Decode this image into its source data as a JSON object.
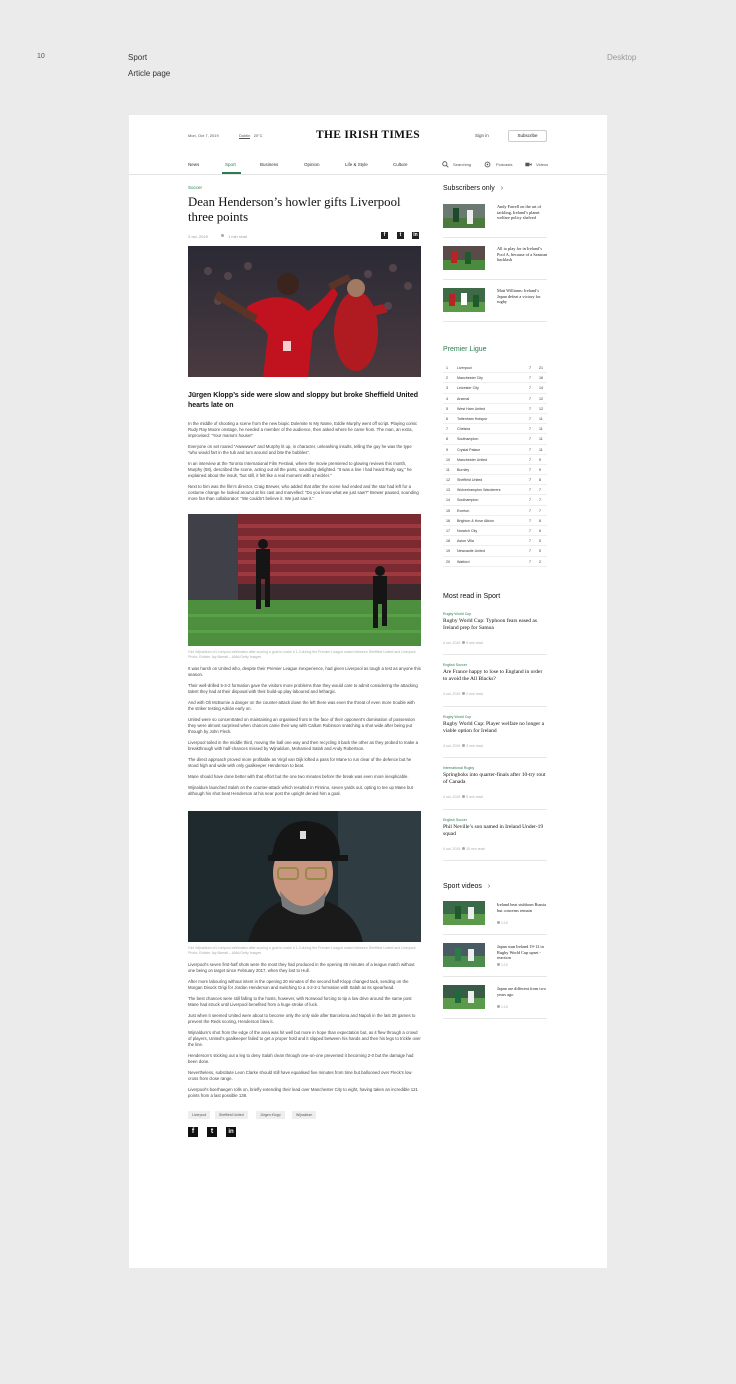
{
  "board": {
    "number": "10",
    "section": "Sport",
    "page": "Article page",
    "device": "Desktop"
  },
  "header": {
    "date": "Mon, Oct 7, 2019",
    "city": "Dublin",
    "temperature": "20°C",
    "logo": "THE IRISH TIMES",
    "signin": "Sign in",
    "subscribe": "Subscribe"
  },
  "nav": {
    "items": [
      "News",
      "Sport",
      "Business",
      "Opinion",
      "Life & Style",
      "Culture"
    ],
    "active": "Sport",
    "tools": [
      "Searching",
      "Podcasts",
      "Videos"
    ]
  },
  "article": {
    "kicker": "Soccer",
    "title": "Dean Henderson’s howler gifts Liverpool three points",
    "date": "2 oct, 2019",
    "read_time": "1 min read",
    "standfirst": "Jürgen Klopp’s side were slow and sloppy but broke Sheffield United hearts late on",
    "paragraphs_a": [
      "In the middle of shooting a scene from the new biopic Dolemite Is My Name, Eddie Murphy went off script. Playing comic Rudy Ray Moore onstage, he needed a member of the audience, then asked where he came from. The man, an extra, improvised: “Your mama’s house!”",
      "Everyone on set roared “Awwwww!” and Murphy lit up, in character, unleashing insults, telling the guy he was the type “who would fart in the tub and turn around and bite the bubbles”.",
      "In an interview at the Toronto International Film Festival, where the movie premiered to glowing reviews this month, Murphy (58), described the scene, acting out all the parts, sounding delighted. “It was a line I had heard Rudy say,” he explained about the insult, “but still, it felt like a real moment with a heckler.”",
      "Next to him was the film’s director, Craig Brewer, who added that after the scene had ended and the star had left for a costume change he looked around at his cast and marvelled: “Do you know what we just saw?” Brewer paused, sounding more fan than collaborator: “We couldn’t believe it. We just saw it.”"
    ],
    "caption1": "Gini Wijnaldum of Liverpool celebrates after scoring a goal to make it 1-0 during the Premier League match between Sheffield United and Liverpool. Photo: Robbie Jay Barratt – AMA/Getty Images",
    "paragraphs_b": [
      "It was harsh on United who, despite their Premier League inexperience, had given Liverpool as tough a test as anyone this season.",
      "Their well-drilled 5-3-2 formation gave the visitors more problems than they would care to admit considering the attacking talent they had at their disposal with their build-up play laboured and lethargic.",
      "And with Oli McBurnie a danger on the counter-attack down the left there was even the threat of even more trouble with the striker testing Adrián early on.",
      "United were so concentrated on maintaining an organised front in the face of their opponent’s domination of possession they were almost surprised when chances came their way with Callum Robinson snatching a shot wide after being put through by John Fleck.",
      "Liverpool toiled in the middle third, moving the ball one way and then recycling it back the other as they probed to make a breakthrough with half-chances missed by Wijnaldum, Mohamed Salah and Andy Robertson.",
      "The direct approach proved more profitable as Virgil van Dijk lofted a pass for Mane to run clear of the defence but he stood high and wide with only goalkeeper Henderson to beat.",
      "Mane should have done better with that effort but the one two minutes before the break was even more inexplicable.",
      "Wijnaldum launched Salah on the counter-attack which resulted in Firmino, seven yards out, opting to tee up Mane but although his shot beat Henderson at his near post the upright denied him a goal."
    ],
    "caption2": "Gini Wijnaldum of Liverpool celebrates after scoring a goal to make it 1-0 during the Premier League match between Sheffield United and Liverpool. Photo: Robbie Jay Barratt – AMA/Getty Images",
    "paragraphs_c": [
      "Liverpool’s seven first-half shots were the most they had produced in the opening 45 minutes of a league match without one being on target since February 2017, when they lost to Hull.",
      "After more labouring without intent in the opening 20 minutes of the second half Klopp changed tack, sending on the Morgan Divock Origi for Jordan Henderson and switching to a 4-2-3-1 formation with Salah as its spearhead.",
      "The best chances were still falling to the hosts, however, with Norwood forcing to tip a low drive around the same post Mane had struck until Liverpool benefited from a huge stroke of luck.",
      "Just when it seemed United were about to become only the only side after Barcelona and Napoli in the last 28 games to prevent the Reds scoring, Henderson blew it.",
      "Wijnaldum’s shot from the edge of the area was hit well but more in hope than expectation but, as it flew through a crowd of players, United’s goalkeeper failed to get a proper hold and it slipped between his hands and then his legs to trickle over the line.",
      "Henderson’s sticking out a leg to deny Salah clean through one-on-one prevented it becoming 2-0 but the damage had been done.",
      "Nevertheless, substitute Leon Clarke should still have equalised five minutes from time but ballooned over Fleck’s low cross from close range.",
      "Liverpool’s boerhaegen rolls on, briefly extending their lead over Manchester City to eight, having taken an incredible 121 points from a last possible 138."
    ],
    "tags": [
      "Liverpool",
      "Sheffield United",
      "Jürgen Klopp",
      "Wijnaldum"
    ]
  },
  "sidebar": {
    "subscribers_heading": "Subscribers only",
    "subscribers": [
      "Andy Farrell on the art of tackling, Ireland’s planet welfare policy shelved",
      "All to play for in Ireland’s Pool A, because of a Samoan backlash",
      "Matt Williams: Ireland’s Japan defeat a victory for rugby"
    ],
    "league_heading": "Premier Ligue",
    "league": [
      {
        "pos": "1",
        "team": "Liverpool",
        "p": "7",
        "pts": "21"
      },
      {
        "pos": "2",
        "team": "Manchester City",
        "p": "7",
        "pts": "16"
      },
      {
        "pos": "3",
        "team": "Leicester City",
        "p": "7",
        "pts": "14"
      },
      {
        "pos": "4",
        "team": "Arsenal",
        "p": "7",
        "pts": "12"
      },
      {
        "pos": "5",
        "team": "West Ham United",
        "p": "7",
        "pts": "12"
      },
      {
        "pos": "6",
        "team": "Tottenham Hotspur",
        "p": "7",
        "pts": "11"
      },
      {
        "pos": "7",
        "team": "Chelsea",
        "p": "7",
        "pts": "11"
      },
      {
        "pos": "8",
        "team": "Southampton",
        "p": "7",
        "pts": "11"
      },
      {
        "pos": "9",
        "team": "Crystal Palace",
        "p": "7",
        "pts": "11"
      },
      {
        "pos": "10",
        "team": "Manchester United",
        "p": "7",
        "pts": "9"
      },
      {
        "pos": "11",
        "team": "Burnley",
        "p": "7",
        "pts": "9"
      },
      {
        "pos": "12",
        "team": "Sheffield United",
        "p": "7",
        "pts": "8"
      },
      {
        "pos": "13",
        "team": "Wolverhampton Wanderers",
        "p": "7",
        "pts": "7"
      },
      {
        "pos": "14",
        "team": "Southampton",
        "p": "7",
        "pts": "7"
      },
      {
        "pos": "15",
        "team": "Everton",
        "p": "7",
        "pts": "7"
      },
      {
        "pos": "16",
        "team": "Brighton & Hove Albion",
        "p": "7",
        "pts": "6"
      },
      {
        "pos": "17",
        "team": "Norwich City",
        "p": "7",
        "pts": "6"
      },
      {
        "pos": "18",
        "team": "Aston Villa",
        "p": "7",
        "pts": "5"
      },
      {
        "pos": "19",
        "team": "Newcastle United",
        "p": "7",
        "pts": "5"
      },
      {
        "pos": "20",
        "team": "Watford",
        "p": "7",
        "pts": "2"
      }
    ],
    "most_read_heading": "Most read in Sport",
    "most_read": [
      {
        "category": "Rugby World Cup",
        "title": "Rugby World Cup: Typhoon fears eased as Ireland prep for Samoa",
        "date": "4 oct, 2019",
        "read": "5 min read"
      },
      {
        "category": "English Soccer",
        "title": "Are France happy to lose to England in order to avoid the All Blacks?",
        "date": "4 oct, 2019",
        "read": "2 min read"
      },
      {
        "category": "Rugby World Cup",
        "title": "Rugby World Cup: Player welfare no longer a viable option for Ireland",
        "date": "4 oct, 2019",
        "read": "3 min read"
      },
      {
        "category": "International Rugby",
        "title": "Springboks into quarter-finals after 10-try rout of Canada",
        "date": "4 oct, 2019",
        "read": "5 min read"
      },
      {
        "category": "English Soccer",
        "title": "Phil Neville’s son named in Ireland Under-19 squad",
        "date": "4 oct, 2019",
        "read": "10 min read"
      }
    ],
    "videos_heading": "Sport videos",
    "videos": [
      {
        "title": "Ireland beat stubborn Russia but concerns remain",
        "duration": "1:10"
      },
      {
        "title": "Japan stun Ireland 19-12 in Rugby World Cup upset - reaction",
        "duration": "1:10"
      },
      {
        "title": "Japan are different from two years ago",
        "duration": "1:10"
      }
    ]
  }
}
